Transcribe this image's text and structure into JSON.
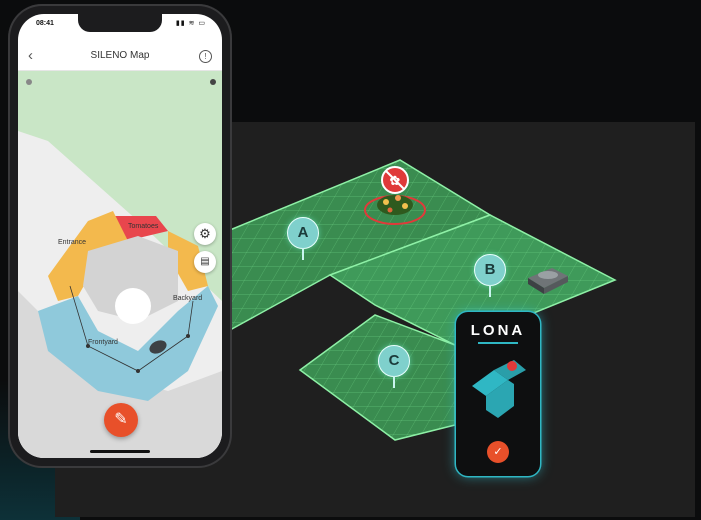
{
  "app": {
    "status_time": "08:41",
    "status_icons": "▮▮ ≋ ▭",
    "title": "SILENO Map",
    "back_icon": "chevron-left-icon",
    "help_icon": "help-circle-icon"
  },
  "map": {
    "labels": {
      "tomatoes": "Tomatoes",
      "entrance": "Entrance",
      "backyard": "Backyard",
      "frontyard": "Frontyard"
    },
    "buttons": {
      "settings_icon": "gear-icon",
      "layers_icon": "layers-icon",
      "edit_icon": "pencil-icon"
    }
  },
  "scene": {
    "zones": [
      "A",
      "B",
      "C"
    ],
    "no_go_icon": "no-go-flower-icon"
  },
  "lona": {
    "logo": "LONA",
    "confirm_icon": "check-icon"
  },
  "colors": {
    "zone_green": "#3f9a5a",
    "marker_teal": "#7fd0cc",
    "accent_orange": "#e8502a",
    "lona_glow": "#2fb7c4",
    "map_red": "#e8464d",
    "map_yellow": "#f3b94d",
    "map_blue": "#8fc9db"
  }
}
